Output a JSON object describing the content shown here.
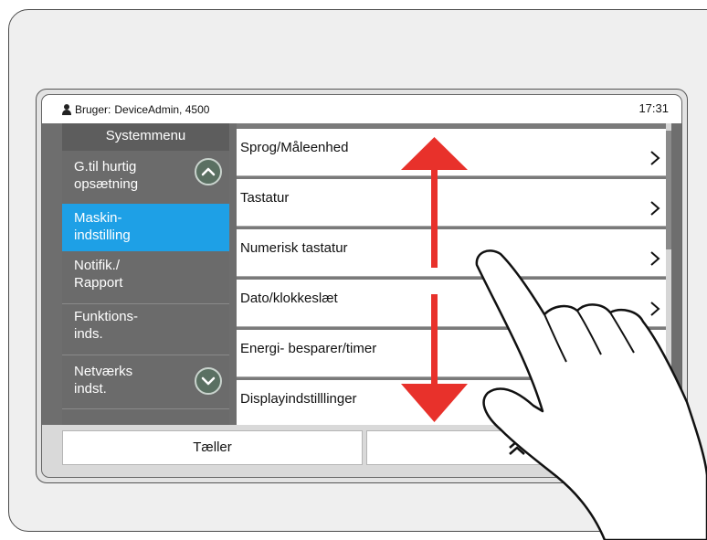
{
  "status": {
    "user_label": "Bruger:",
    "user_value": "DeviceAdmin, 4500",
    "time": "17:31"
  },
  "sidebar": {
    "title": "Systemmenu",
    "items": [
      {
        "label": "G.til hurtig\nopsætning"
      },
      {
        "label": "Maskin-\nindstilling",
        "active": true
      },
      {
        "label": "Notifik./\nRapport"
      },
      {
        "label": "Funktions-\ninds."
      },
      {
        "label": "Netværks\nindst."
      }
    ]
  },
  "list": {
    "items": [
      "Sprog/Måleenhed",
      "Tastatur",
      "Numerisk tastatur",
      "Dato/klokkeslæt",
      "Energi- besparer/timer",
      "Displayindstilllinger"
    ]
  },
  "bottom": {
    "counter_label": "Tæller"
  },
  "colors": {
    "active": "#1ea0e6",
    "arrow": "#e8312b",
    "sidebar": "#6b6b6b"
  },
  "icons": [
    "person-icon",
    "scroll-up-icon",
    "scroll-down-icon",
    "chevron-right-icon",
    "double-chevron-up-icon",
    "swipe-arrow-icon",
    "hand-pointer-illustration"
  ]
}
